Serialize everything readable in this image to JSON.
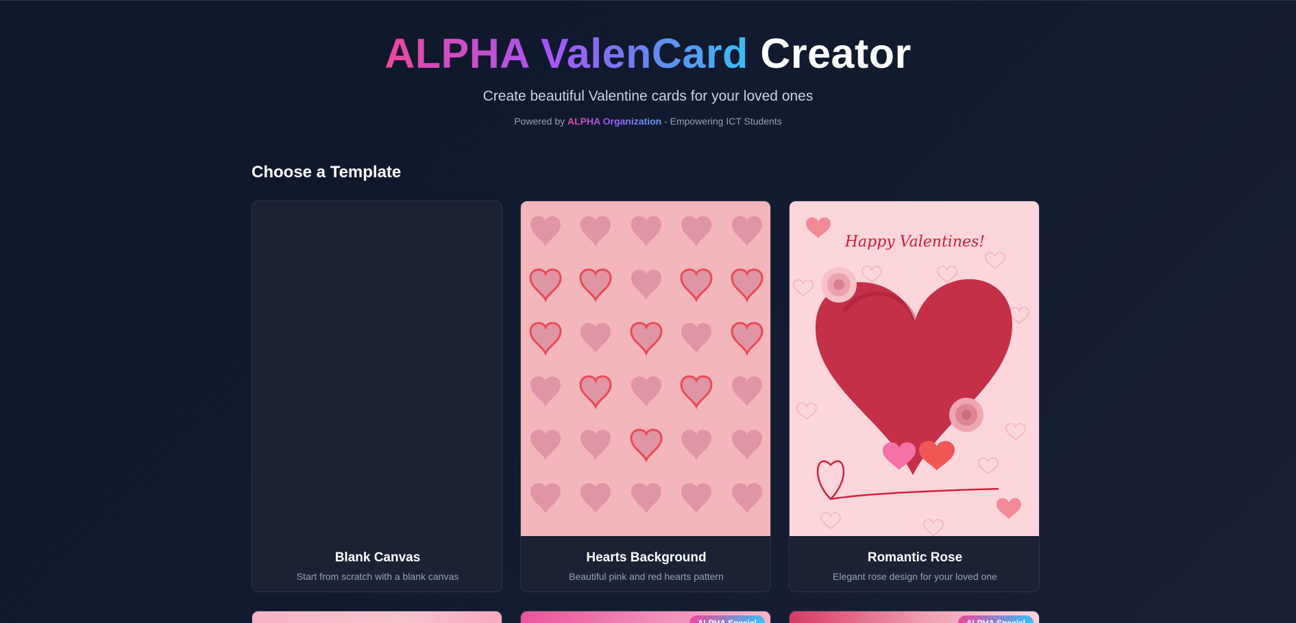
{
  "header": {
    "title_gradient": "ALPHA ValenCard",
    "title_plain": "Creator",
    "subtitle": "Create beautiful Valentine cards for your loved ones",
    "powered_prefix": "Powered by ",
    "powered_org": "ALPHA Organization",
    "powered_suffix": " - Empowering ICT Students"
  },
  "section": {
    "title": "Choose a Template"
  },
  "templates": [
    {
      "name": "Blank Canvas",
      "description": "Start from scratch with a blank canvas"
    },
    {
      "name": "Hearts Background",
      "description": "Beautiful pink and red hearts pattern"
    },
    {
      "name": "Romantic Rose",
      "description": "Elegant rose design for your loved one",
      "card_text": "Happy Valentines!"
    }
  ],
  "templates_row2": [
    {
      "badge": ""
    },
    {
      "badge": "ALPHA Special"
    },
    {
      "badge": "ALPHA Special"
    }
  ],
  "colors": {
    "background": "#0f172a",
    "card_bg": "#1b2234",
    "accent_pink": "#ec4899",
    "accent_purple": "#a855f7",
    "accent_blue": "#38bdf8"
  }
}
